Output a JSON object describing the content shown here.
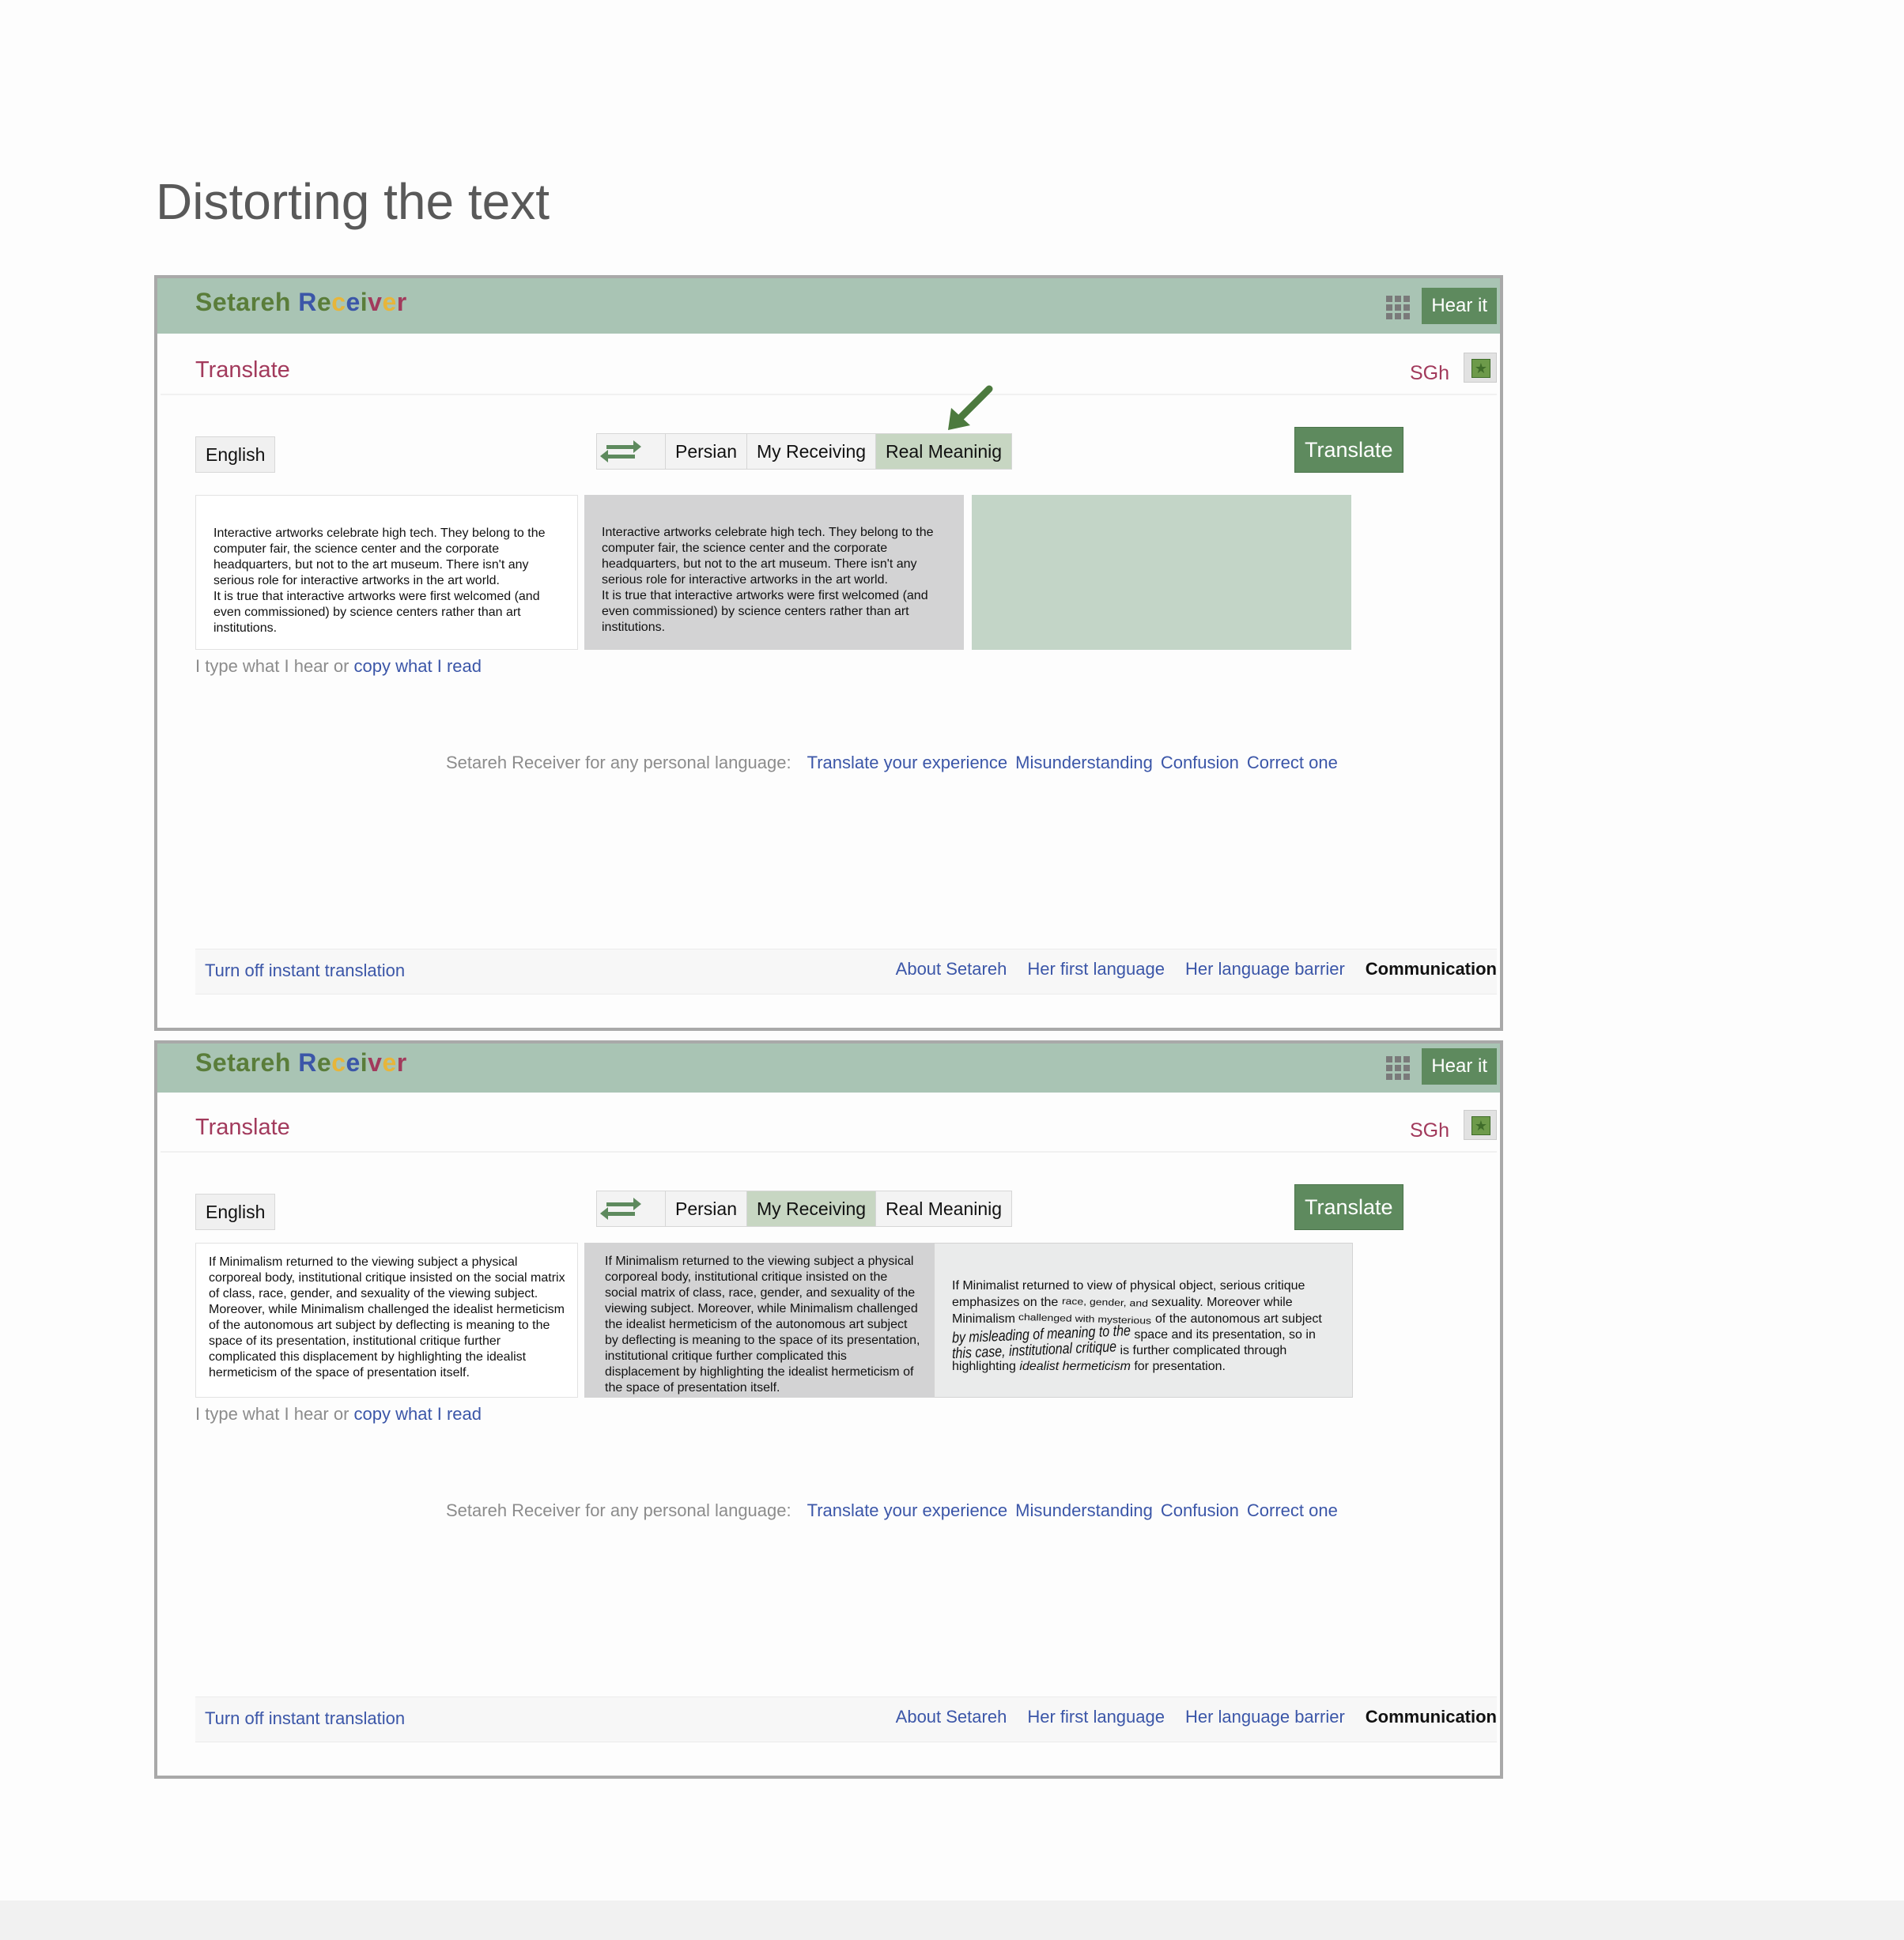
{
  "page": {
    "title": "Distorting the text"
  },
  "icons": {
    "grid": "apps-grid-icon",
    "star": "star-icon",
    "swap": "swap-arrows-icon",
    "pointer": "pointer-arrow-icon"
  },
  "colors": {
    "header": "#a9c4b4",
    "accent_green": "#5e8a5e",
    "link_blue": "#3b56a8",
    "title_red": "#a23a5c",
    "active_tab": "#c7d6c2"
  },
  "brand": {
    "letters": [
      {
        "ch": "Setareh ",
        "color": "#5a7d3a"
      },
      {
        "ch": "R",
        "color": "#3b56a8"
      },
      {
        "ch": "e",
        "color": "#5a7d3a"
      },
      {
        "ch": "c",
        "color": "#e7b53a"
      },
      {
        "ch": "e",
        "color": "#3b56a8"
      },
      {
        "ch": "i",
        "color": "#5a7d3a"
      },
      {
        "ch": "v",
        "color": "#a23a5c"
      },
      {
        "ch": "e",
        "color": "#e7b53a"
      },
      {
        "ch": "r",
        "color": "#a23a5c"
      }
    ]
  },
  "header": {
    "hear_label": "Hear it",
    "section_title": "Translate",
    "user": "SGh"
  },
  "toolbar": {
    "source_lang": "English",
    "tab_persian": "Persian",
    "tab_my_receiving": "My Receiving",
    "tab_real_meaning": "Real Meaninig",
    "translate_label": "Translate"
  },
  "panels": [
    {
      "active_tab": "Real Meaninig",
      "source_text": "Interactive artworks celebrate high tech. They belong to the computer fair, the science center and the corporate headquarters, but not to the art museum. There isn't any serious role for interactive artworks in the art world.\nIt is true that interactive artworks were first welcomed (and even commissioned) by science centers rather than art institutions.",
      "middle_text": "Interactive artworks celebrate high tech. They belong to the computer fair, the science center and the corporate headquarters, but not to the art museum. There isn't any serious role for interactive artworks in the art world.\nIt is true that interactive artworks were first welcomed (and even commissioned) by science centers rather than art institutions."
    },
    {
      "active_tab": "My Receiving",
      "source_text": "If Minimalism returned to the viewing subject a physical corporeal body, institutional critique insisted on the social matrix of class, race, gender, and sexuality of the viewing subject. Moreover, while Minimalism challenged the idealist hermeticism of the autonomous art subject by deflecting is meaning to the space of its presentation, institutional critique further complicated this displacement by highlighting the idealist hermeticism of the space of presentation itself.",
      "middle_text": "If Minimalism returned to the viewing subject a physical corporeal body, institutional critique insisted on the social matrix of class, race, gender, and sexuality of the viewing subject. Moreover, while Minimalism challenged the idealist hermeticism of the autonomous art subject by deflecting is meaning to the space of its presentation, institutional critique further complicated this displacement by highlighting the idealist hermeticism of the space of presentation itself.",
      "out_parts": {
        "s1": "If Minimalist returned to view of physical object, serious critique emphasizes on the ",
        "s2": "race, gender, and",
        "s3": " sexuality. Moreover while Minimalism ",
        "s4": "challenged with mysterious",
        "s5": " of the autonomous art subject ",
        "s6": "by misleading of meaning to the",
        "s7": " space and its presentation, so in ",
        "s8": "this case, institutional critique",
        "s9": " is further complicated through highlighting ",
        "s10": "idealist hermeticism",
        "s11": " for presentation."
      }
    }
  ],
  "hint": {
    "prefix": "I type what I hear or ",
    "link": "copy what I read"
  },
  "langline": {
    "prefix": "Setareh Receiver for any personal language:",
    "links": [
      "Translate your experience",
      "Misunderstanding",
      "Confusion",
      "Correct one"
    ]
  },
  "footer": {
    "off": "Turn off instant translation",
    "links": [
      "About Setareh",
      "Her first language",
      "Her language barrier"
    ],
    "bold": "Communication"
  }
}
